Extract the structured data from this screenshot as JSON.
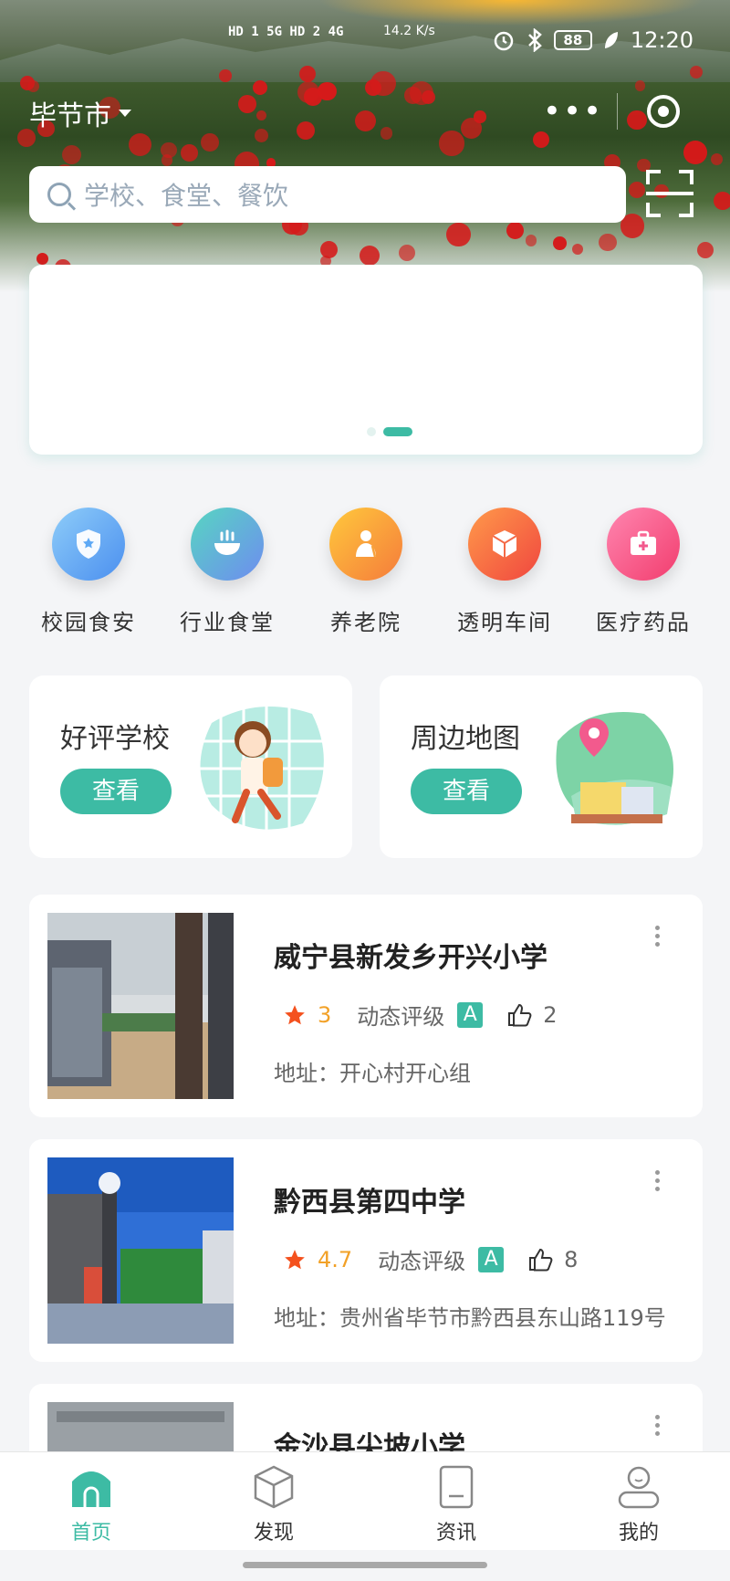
{
  "status_bar": {
    "network": "HD 1 5G  HD 2 4G",
    "speed": "14.2 K/s",
    "battery": "88",
    "time": "12:20"
  },
  "header": {
    "city": "毕节市",
    "more_icon": "more-dots-icon",
    "target_icon": "record-target-icon"
  },
  "search": {
    "placeholder": "学校、食堂、餐饮"
  },
  "banner": {
    "active_index": 1,
    "count": 2
  },
  "categories": [
    {
      "label": "校园食安",
      "icon": "shield-icon",
      "color": "#5ea9f5"
    },
    {
      "label": "行业食堂",
      "icon": "bowl-icon",
      "color": "#4ec1c9"
    },
    {
      "label": "养老院",
      "icon": "elder-icon",
      "color": "#f7a23c"
    },
    {
      "label": "透明车间",
      "icon": "box-icon",
      "color": "#f46a47"
    },
    {
      "label": "医疗药品",
      "icon": "medkit-icon",
      "color": "#f25a8d"
    }
  ],
  "quick_cards": [
    {
      "title": "好评学校",
      "button": "查看"
    },
    {
      "title": "周边地图",
      "button": "查看"
    }
  ],
  "list": [
    {
      "name": "威宁县新发乡开兴小学",
      "score": "3",
      "rating_label": "动态评级",
      "grade": "A",
      "likes": "2",
      "address": "地址：开心村开心组"
    },
    {
      "name": "黔西县第四中学",
      "score": "4.7",
      "rating_label": "动态评级",
      "grade": "A",
      "likes": "8",
      "address": "地址：贵州省毕节市黔西县东山路119号"
    },
    {
      "name": "金沙县尖坡小学"
    }
  ],
  "tabbar": [
    {
      "label": "首页",
      "icon": "home-icon"
    },
    {
      "label": "发现",
      "icon": "discover-cube-icon"
    },
    {
      "label": "资讯",
      "icon": "news-doc-icon"
    },
    {
      "label": "我的",
      "icon": "profile-icon"
    }
  ],
  "colors": {
    "accent": "#3dbba4",
    "star": "#f2a127",
    "text": "#333333"
  }
}
